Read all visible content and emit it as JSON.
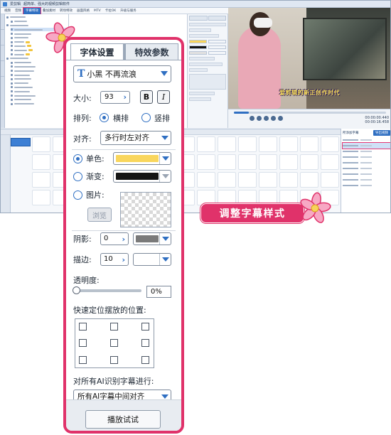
{
  "app": {
    "title": "爱剪辑",
    "subtitle": "超简单、强大的视频剪辑软件",
    "menu": [
      "视频",
      "音频",
      "字幕特效",
      "叠加素材",
      "转场特效",
      "画面风格",
      "MTV",
      "卡拉OK",
      "升级与服务"
    ],
    "active_menu": "字幕特效",
    "player": {
      "subtitle_text": "爱剪辑的新正创作时代",
      "time_current": "00:00:00.440",
      "time_total": "00:00:16.458",
      "progress": 0.1
    },
    "side_list": {
      "title": "所添加字幕",
      "export_label": "导出视频"
    }
  },
  "panel": {
    "tab_font": "字体设置",
    "tab_effects": "特效参数",
    "font_name": "小黑 不再流浪",
    "size_label": "大小:",
    "size_value": "93",
    "bold_label": "B",
    "italic_label": "I",
    "arrange_label": "排列:",
    "arrange_horizontal": "横排",
    "arrange_vertical": "竖排",
    "arrange_selected": "横排",
    "align_label": "对齐:",
    "align_value": "多行时左对齐",
    "solid_label": "单色:",
    "solid_color": "#f9d65c",
    "gradient_label": "渐变:",
    "gradient_color": "#151515",
    "image_label": "图片:",
    "browse_label": "浏览",
    "fill_selected": "单色",
    "shadow_label": "阴影:",
    "shadow_value": "0",
    "shadow_color": "#7a7a7a",
    "stroke_label": "描边:",
    "stroke_value": "10",
    "stroke_color": "#ffffff",
    "opacity_label": "透明度:",
    "opacity_value": "0%",
    "opacity": 0,
    "position_label": "快速定位摆放的位置:",
    "ai_label": "对所有AI识别字幕进行:",
    "ai_value": "所有AI字幕中间对齐",
    "play_button": "播放试试"
  },
  "callout": {
    "text": "调整字幕样式",
    "color": "#e0326a"
  },
  "colors": {
    "accent": "#2f6fc2",
    "highlight": "#e0326a"
  }
}
